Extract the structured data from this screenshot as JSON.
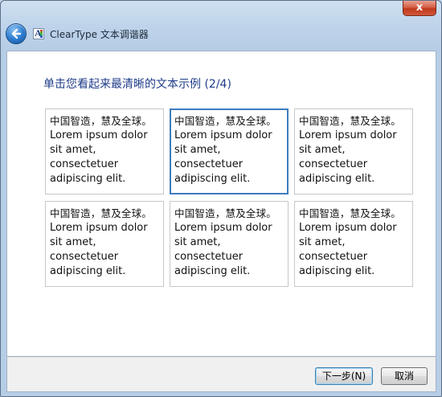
{
  "window": {
    "title": "ClearType 文本调谐器",
    "close_label": "x"
  },
  "content": {
    "heading": "单击您看起来最清晰的文本示例 (2/4)",
    "samples": [
      {
        "cn": "中国智造，慧及全球。",
        "en": "Lorem ipsum dolor\nsit amet,\nconsectetuer\nadipiscing elit.",
        "selected": false
      },
      {
        "cn": "中国智造，慧及全球。",
        "en": "Lorem ipsum dolor\nsit amet,\nconsectetuer\nadipiscing elit.",
        "selected": true
      },
      {
        "cn": "中国智造，慧及全球。",
        "en": "Lorem ipsum dolor\nsit amet,\nconsectetuer\nadipiscing elit.",
        "selected": false
      },
      {
        "cn": "中国智造，慧及全球。",
        "en": "Lorem ipsum dolor\nsit amet,\nconsectetuer\nadipiscing elit.",
        "selected": false
      },
      {
        "cn": "中国智造，慧及全球。",
        "en": "Lorem ipsum dolor\nsit amet,\nconsectetuer\nadipiscing elit.",
        "selected": false
      },
      {
        "cn": "中国智造，慧及全球。",
        "en": "Lorem ipsum dolor\nsit amet,\nconsectetuer\nadipiscing elit.",
        "selected": false
      }
    ]
  },
  "buttons": {
    "next_label": "下一步(N)",
    "cancel_label": "取消"
  },
  "colors": {
    "heading": "#1f3c8a",
    "selected_border": "#3e7bbf"
  },
  "icons": {
    "back": "back-arrow-icon",
    "app": "cleartype-app-icon",
    "close": "close-icon"
  }
}
